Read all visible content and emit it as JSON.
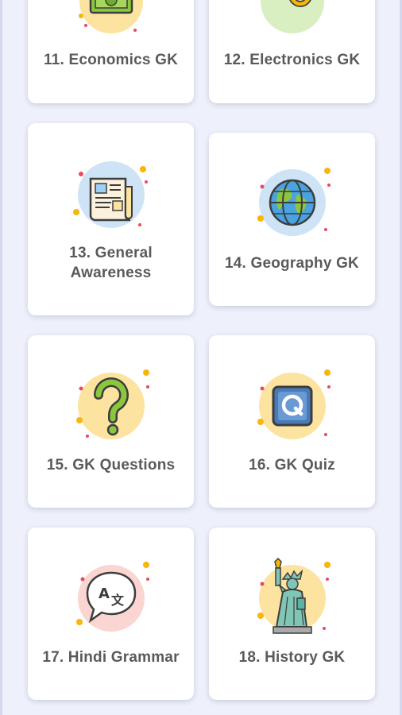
{
  "grid": {
    "items": [
      {
        "label": "11. Economics GK",
        "icon": "money-icon"
      },
      {
        "label": "12. Electronics GK",
        "icon": "electric-plug-icon"
      },
      {
        "label": "13. General\nAwareness",
        "icon": "newspaper-icon"
      },
      {
        "label": "14. Geography GK",
        "icon": "globe-icon"
      },
      {
        "label": "15. GK Questions",
        "icon": "question-mark-icon"
      },
      {
        "label": "16. GK Quiz",
        "icon": "quiz-q-icon"
      },
      {
        "label": "17. Hindi Grammar",
        "icon": "translate-bubble-icon"
      },
      {
        "label": "18. History GK",
        "icon": "statue-of-liberty-icon"
      }
    ]
  },
  "colors": {
    "background": "#eef0fb",
    "card": "#ffffff",
    "label_text": "#5a5a5a",
    "circle_yellow": "#fde3a0",
    "circle_blue": "#cfe3f7",
    "circle_green": "#d9efc1",
    "circle_pink": "#fbd5d2",
    "accent_orange": "#f6b60a"
  }
}
